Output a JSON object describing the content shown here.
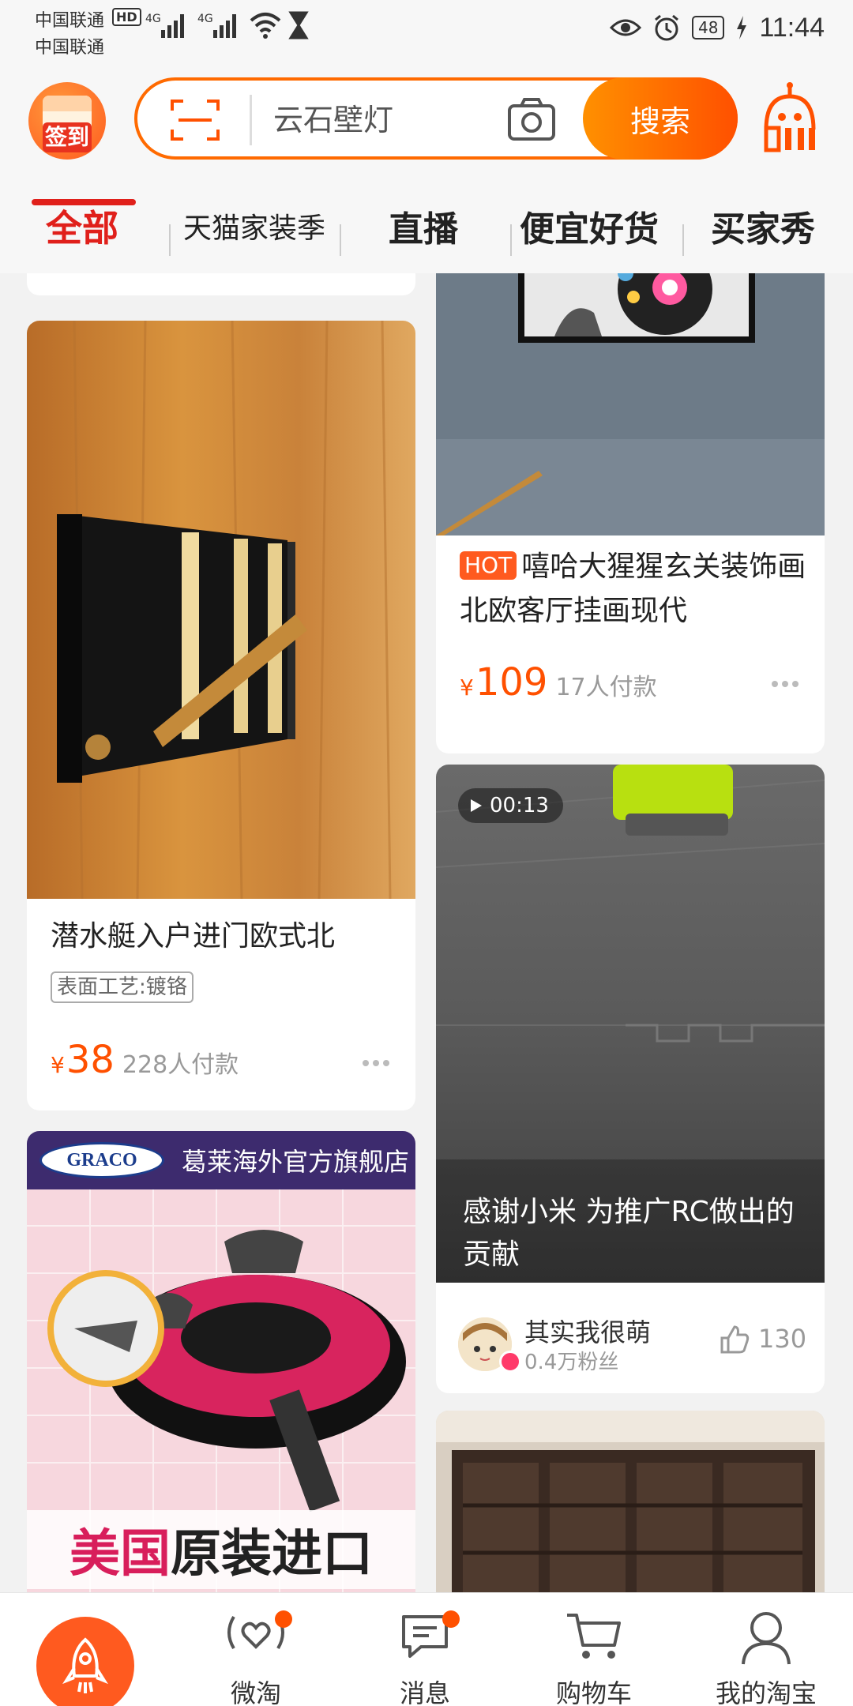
{
  "status_bar": {
    "carrier_1": "中国联通",
    "carrier_2": "中国联通",
    "hd_badge": "HD",
    "net_1": "4G",
    "net_2": "4G",
    "battery": "48",
    "time": "11:44"
  },
  "header": {
    "signin_label": "签到",
    "search_placeholder": "云石壁灯",
    "search_button": "搜索"
  },
  "tabs": [
    {
      "label": "全部",
      "active": true
    },
    {
      "label": "天猫家装季",
      "active": false
    },
    {
      "label": "直播",
      "active": false
    },
    {
      "label": "便宜好货",
      "active": false
    },
    {
      "label": "买家秀",
      "active": false
    }
  ],
  "feed": {
    "coat_hook": {
      "title": "潜水艇入户进门欧式北",
      "tag": "表面工艺:镀铬",
      "currency": "¥",
      "price": "38",
      "sold": "228人付款"
    },
    "painting": {
      "badge": "HOT",
      "title": "嘻哈大猩猩玄关装饰画北欧客厅挂画现代",
      "currency": "¥",
      "price": "109",
      "sold": "17人付款"
    },
    "video": {
      "duration": "00:13",
      "caption": "感谢小米 为推广RC做出的贡献",
      "author": "其实我很萌",
      "fans": "0.4万粉丝",
      "likes": "130"
    },
    "car_seat": {
      "brand": "GRACO",
      "store": "葛莱海外官方旗舰店",
      "promo_a": "美国",
      "promo_b": "原装进口"
    }
  },
  "bottom_nav": [
    {
      "label": "",
      "icon": "rocket-icon"
    },
    {
      "label": "微淘",
      "icon": "weitao-icon"
    },
    {
      "label": "消息",
      "icon": "message-icon"
    },
    {
      "label": "购物车",
      "icon": "cart-icon"
    },
    {
      "label": "我的淘宝",
      "icon": "profile-icon"
    }
  ],
  "colors": {
    "brand_orange": "#ff5000",
    "tab_active": "#e0201b",
    "store_banner": "#3d2b6e"
  }
}
